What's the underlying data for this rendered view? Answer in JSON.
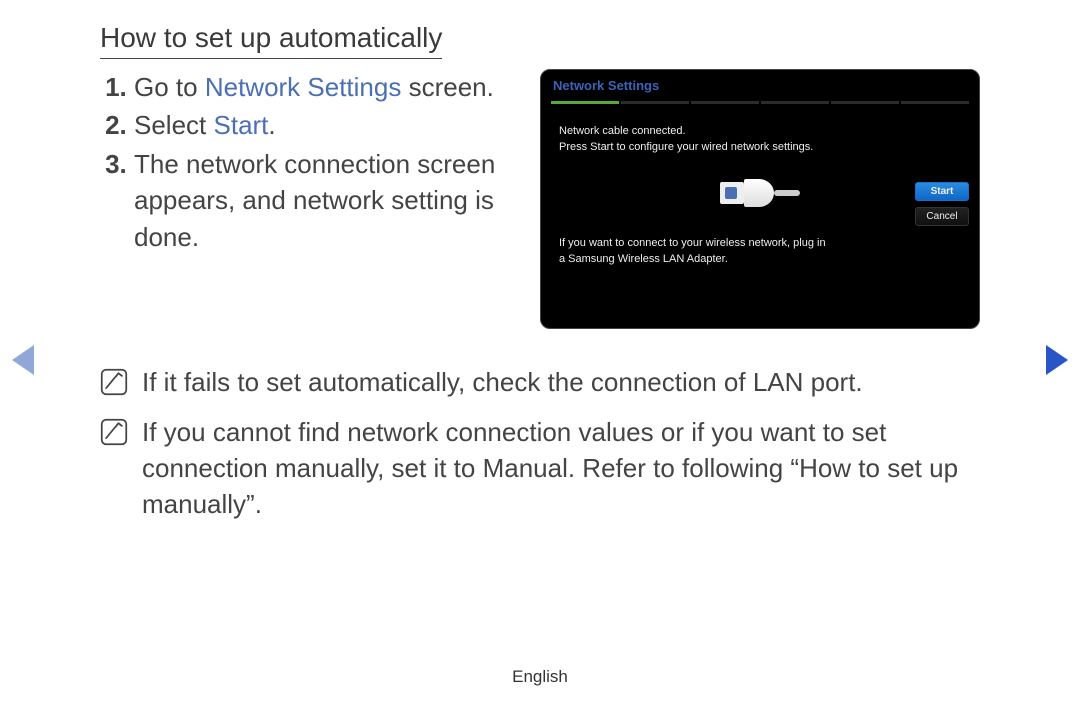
{
  "title": "How to set up automatically",
  "steps": {
    "s1_a": "Go to ",
    "s1_link": "Network Settings",
    "s1_b": " screen.",
    "s2_a": "Select ",
    "s2_link": "Start",
    "s2_b": ".",
    "s3": "The network connection screen appears, and network setting is done."
  },
  "screenshot": {
    "title": "Network Settings",
    "msg1": "Network cable connected.",
    "msg2": "Press Start to configure your wired network settings.",
    "btn_start": "Start",
    "btn_cancel": "Cancel",
    "hint1": "If you want to connect to your wireless network, plug in",
    "hint2": "a Samsung Wireless LAN Adapter."
  },
  "notes": {
    "n1": "If it fails to set automatically, check the connection of LAN port.",
    "n2": "If you cannot find network connection values or if you want to set connection manually, set it to Manual. Refer to following “How to set up manually”."
  },
  "footer": "English"
}
